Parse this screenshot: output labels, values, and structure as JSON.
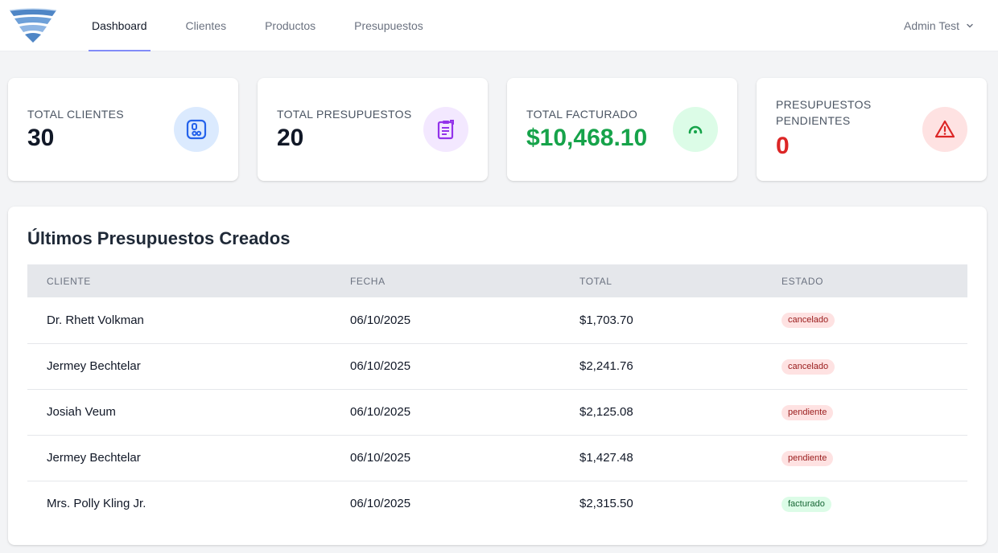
{
  "nav": {
    "tabs": [
      {
        "label": "Dashboard",
        "active": true
      },
      {
        "label": "Clientes",
        "active": false
      },
      {
        "label": "Productos",
        "active": false
      },
      {
        "label": "Presupuestos",
        "active": false
      }
    ],
    "user": "Admin Test"
  },
  "stats": [
    {
      "label": "TOTAL CLIENTES",
      "value": "30",
      "icon": "users-icon",
      "icon_bg": "#dbeafe",
      "icon_color": "#2563eb"
    },
    {
      "label": "TOTAL PRESUPUESTOS",
      "value": "20",
      "icon": "clipboard-icon",
      "icon_bg": "#f3e8ff",
      "icon_color": "#9333ea"
    },
    {
      "label": "TOTAL FACTURADO",
      "value": "$10,468.10",
      "icon": "gauge-icon",
      "icon_bg": "#dcfce7",
      "icon_color": "#16a34a",
      "value_color": "#16a34a"
    },
    {
      "label": "PRESUPUESTOS PENDIENTES",
      "value": "0",
      "icon": "warning-icon",
      "icon_bg": "#fee2e2",
      "icon_color": "#dc2626",
      "value_color": "#dc2626"
    }
  ],
  "recent": {
    "title": "Últimos Presupuestos Creados",
    "columns": [
      "CLIENTE",
      "FECHA",
      "TOTAL",
      "ESTADO"
    ],
    "rows": [
      {
        "cliente": "Dr. Rhett Volkman",
        "fecha": "06/10/2025",
        "total": "$1,703.70",
        "estado": "cancelado"
      },
      {
        "cliente": "Jermey Bechtelar",
        "fecha": "06/10/2025",
        "total": "$2,241.76",
        "estado": "cancelado"
      },
      {
        "cliente": "Josiah Veum",
        "fecha": "06/10/2025",
        "total": "$2,125.08",
        "estado": "pendiente"
      },
      {
        "cliente": "Jermey Bechtelar",
        "fecha": "06/10/2025",
        "total": "$1,427.48",
        "estado": "pendiente"
      },
      {
        "cliente": "Mrs. Polly Kling Jr.",
        "fecha": "06/10/2025",
        "total": "$2,315.50",
        "estado": "facturado"
      }
    ]
  }
}
